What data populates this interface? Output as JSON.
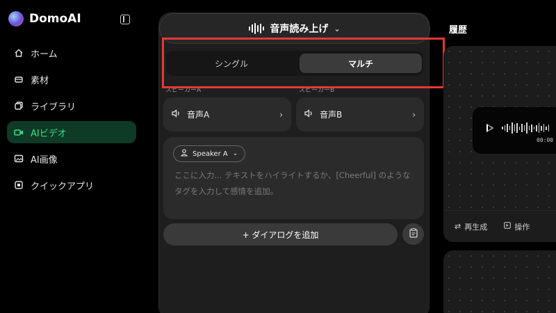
{
  "brand": {
    "name": "DomoAI"
  },
  "sidebar": {
    "items": [
      {
        "label": "ホーム",
        "icon": "home-icon",
        "active": false
      },
      {
        "label": "素材",
        "icon": "material-icon",
        "active": false
      },
      {
        "label": "ライブラリ",
        "icon": "library-icon",
        "active": false
      },
      {
        "label": "AIビデオ",
        "icon": "video-icon",
        "active": true
      },
      {
        "label": "AI画像",
        "icon": "image-icon",
        "active": false
      },
      {
        "label": "クイックアプリ",
        "icon": "quick-app-icon",
        "active": false
      }
    ]
  },
  "mode_selector": {
    "label": "音声読み上げ"
  },
  "speaker_toggle": {
    "single": "シングル",
    "multi": "マルチ",
    "selected": "マルチ"
  },
  "speakers": [
    {
      "label": "スピーカーA",
      "voice": "音声A"
    },
    {
      "label": "スピーカーB",
      "voice": "音声B"
    }
  ],
  "dialog": {
    "speaker": "Speaker A",
    "placeholder": "ここに入力... テキストをハイライトするか、[Cheerful] のようなタグを入力して感情を追加。"
  },
  "add_dialog": {
    "label": "+ ダイアログを追加"
  },
  "history": {
    "title": "履歴",
    "items": [
      {
        "time": "00:00",
        "regenerate": "再生成",
        "actions": "操作"
      }
    ]
  },
  "colors": {
    "accent": "#35e08a",
    "active_bg": "#0e3a26",
    "highlight": "#e53935"
  }
}
